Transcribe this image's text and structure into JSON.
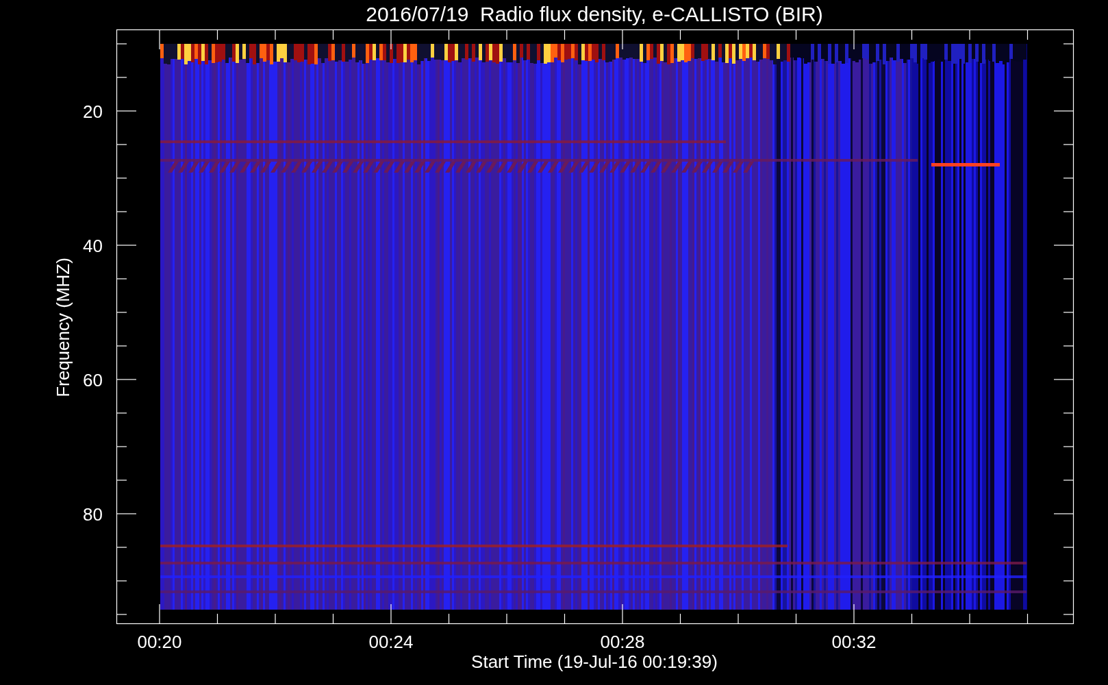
{
  "title": "2016/07/19  Radio flux density, e-CALLISTO (BIR)",
  "y_axis": {
    "label": "Frequency (MHZ)",
    "ticks": [
      "20",
      "40",
      "60",
      "80"
    ]
  },
  "x_axis": {
    "label": "Start Time (19-Jul-16 00:19:39)",
    "ticks": [
      "00:20",
      "00:24",
      "00:28",
      "00:32"
    ]
  }
}
